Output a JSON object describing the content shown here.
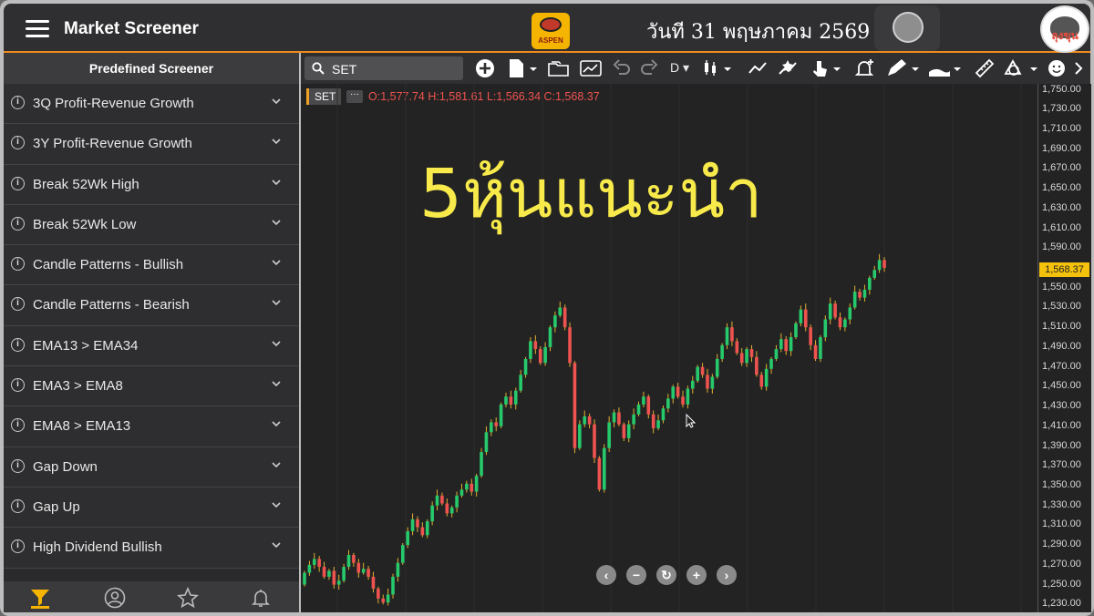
{
  "header": {
    "title": "Market Screener",
    "logo_text": "ASPEN",
    "date_text": "วันที 31 พฤษภาคม 2569",
    "avatar_text": "ลุงขุน"
  },
  "sidebar": {
    "heading": "Predefined Screener",
    "items": [
      {
        "label": "3Q Profit-Revenue Growth"
      },
      {
        "label": "3Y Profit-Revenue Growth"
      },
      {
        "label": "Break 52Wk High"
      },
      {
        "label": "Break 52Wk Low"
      },
      {
        "label": "Candle Patterns - Bullish"
      },
      {
        "label": "Candle Patterns - Bearish"
      },
      {
        "label": "EMA13 > EMA34"
      },
      {
        "label": "EMA3 > EMA8"
      },
      {
        "label": "EMA8 > EMA13"
      },
      {
        "label": "Gap Down"
      },
      {
        "label": "Gap Up"
      },
      {
        "label": "High Dividend Bullish"
      }
    ],
    "bottom_icons": [
      "filter-icon",
      "user-icon",
      "star-icon",
      "bell-icon"
    ]
  },
  "toolbar": {
    "search_value": "SET",
    "interval_label": "D"
  },
  "chart_header": {
    "symbol": "SET",
    "more": "···",
    "ohlc_text": "O:1,577.74 H:1,581.61 L:1,566.34 C:1,568.37"
  },
  "headline": "5หุ้นแนะนำ",
  "colors": {
    "up": "#26c96b",
    "down": "#ef5350",
    "accent": "#f08a1c",
    "headline": "#f7ea4a"
  },
  "chart_data": {
    "type": "candlestick",
    "symbol": "SET",
    "last_price": "1,568.37",
    "ylim": [
      1222,
      1756
    ],
    "y_ticks": [
      "1,750.00",
      "1,730.00",
      "1,710.00",
      "1,690.00",
      "1,670.00",
      "1,650.00",
      "1,630.00",
      "1,610.00",
      "1,590.00",
      "1,570.00",
      "1,550.00",
      "1,530.00",
      "1,510.00",
      "1,490.00",
      "1,470.00",
      "1,450.00",
      "1,430.00",
      "1,410.00",
      "1,390.00",
      "1,370.00",
      "1,350.00",
      "1,330.00",
      "1,310.00",
      "1,290.00",
      "1,270.00",
      "1,250.00",
      "1,230.00"
    ],
    "candles": [
      [
        1250,
        1262
      ],
      [
        1262,
        1270
      ],
      [
        1270,
        1276
      ],
      [
        1276,
        1268
      ],
      [
        1268,
        1258
      ],
      [
        1258,
        1264
      ],
      [
        1264,
        1250
      ],
      [
        1250,
        1254
      ],
      [
        1254,
        1268
      ],
      [
        1268,
        1280
      ],
      [
        1280,
        1272
      ],
      [
        1272,
        1262
      ],
      [
        1262,
        1266
      ],
      [
        1266,
        1258
      ],
      [
        1258,
        1246
      ],
      [
        1246,
        1236
      ],
      [
        1236,
        1232
      ],
      [
        1232,
        1240
      ],
      [
        1240,
        1258
      ],
      [
        1258,
        1272
      ],
      [
        1272,
        1290
      ],
      [
        1290,
        1304
      ],
      [
        1304,
        1316
      ],
      [
        1316,
        1308
      ],
      [
        1308,
        1300
      ],
      [
        1300,
        1314
      ],
      [
        1314,
        1330
      ],
      [
        1330,
        1340
      ],
      [
        1340,
        1332
      ],
      [
        1332,
        1322
      ],
      [
        1322,
        1328
      ],
      [
        1328,
        1340
      ],
      [
        1340,
        1346
      ],
      [
        1346,
        1352
      ],
      [
        1352,
        1344
      ],
      [
        1344,
        1360
      ],
      [
        1360,
        1384
      ],
      [
        1384,
        1404
      ],
      [
        1404,
        1414
      ],
      [
        1414,
        1410
      ],
      [
        1410,
        1432
      ],
      [
        1432,
        1440
      ],
      [
        1440,
        1432
      ],
      [
        1432,
        1446
      ],
      [
        1446,
        1462
      ],
      [
        1462,
        1478
      ],
      [
        1478,
        1496
      ],
      [
        1496,
        1488
      ],
      [
        1488,
        1474
      ],
      [
        1474,
        1490
      ],
      [
        1490,
        1510
      ],
      [
        1510,
        1522
      ],
      [
        1522,
        1530
      ],
      [
        1530,
        1510
      ],
      [
        1510,
        1474
      ],
      [
        1474,
        1388
      ],
      [
        1388,
        1412
      ],
      [
        1412,
        1420
      ],
      [
        1420,
        1412
      ],
      [
        1412,
        1378
      ],
      [
        1378,
        1346
      ],
      [
        1346,
        1388
      ],
      [
        1388,
        1414
      ],
      [
        1414,
        1424
      ],
      [
        1424,
        1412
      ],
      [
        1412,
        1398
      ],
      [
        1398,
        1412
      ],
      [
        1412,
        1422
      ],
      [
        1422,
        1432
      ],
      [
        1432,
        1440
      ],
      [
        1440,
        1422
      ],
      [
        1422,
        1408
      ],
      [
        1408,
        1416
      ],
      [
        1416,
        1428
      ],
      [
        1428,
        1438
      ],
      [
        1438,
        1450
      ],
      [
        1450,
        1440
      ],
      [
        1440,
        1432
      ],
      [
        1432,
        1448
      ],
      [
        1448,
        1456
      ],
      [
        1456,
        1470
      ],
      [
        1470,
        1462
      ],
      [
        1462,
        1448
      ],
      [
        1448,
        1460
      ],
      [
        1460,
        1478
      ],
      [
        1478,
        1492
      ],
      [
        1492,
        1510
      ],
      [
        1510,
        1496
      ],
      [
        1496,
        1484
      ],
      [
        1484,
        1474
      ],
      [
        1474,
        1488
      ],
      [
        1488,
        1480
      ],
      [
        1480,
        1462
      ],
      [
        1462,
        1450
      ],
      [
        1450,
        1468
      ],
      [
        1468,
        1478
      ],
      [
        1478,
        1488
      ],
      [
        1488,
        1498
      ],
      [
        1498,
        1486
      ],
      [
        1486,
        1500
      ],
      [
        1500,
        1514
      ],
      [
        1514,
        1528
      ],
      [
        1528,
        1510
      ],
      [
        1510,
        1492
      ],
      [
        1492,
        1478
      ],
      [
        1478,
        1500
      ],
      [
        1500,
        1518
      ],
      [
        1518,
        1534
      ],
      [
        1534,
        1520
      ],
      [
        1520,
        1510
      ],
      [
        1510,
        1518
      ],
      [
        1518,
        1530
      ],
      [
        1530,
        1546
      ],
      [
        1546,
        1540
      ],
      [
        1540,
        1548
      ],
      [
        1548,
        1560
      ],
      [
        1560,
        1568
      ],
      [
        1568,
        1578
      ],
      [
        1578,
        1570
      ]
    ]
  }
}
